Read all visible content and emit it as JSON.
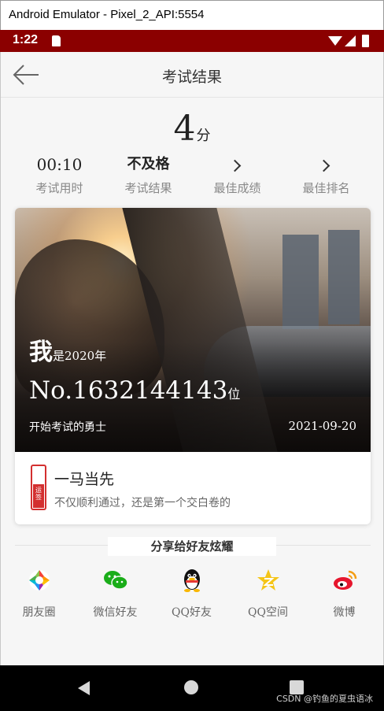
{
  "window": {
    "title": "Android Emulator - Pixel_2_API:5554"
  },
  "status_bar": {
    "time": "1:22"
  },
  "appbar": {
    "title": "考试结果"
  },
  "score": {
    "value": "4",
    "unit": "分"
  },
  "stats": [
    {
      "value": "00:10",
      "label": "考试用时"
    },
    {
      "value": "不及格",
      "label": "考试结果"
    },
    {
      "value": "",
      "label": "最佳成绩"
    },
    {
      "value": "",
      "label": "最佳排名"
    }
  ],
  "rank_card": {
    "me_big": "我",
    "me_small": "是2020年",
    "rank_prefix": "No.1632144143",
    "rank_suffix": "位",
    "caption": "开始考试的勇士",
    "date": "2021-09-20",
    "badge_text": "运签",
    "title": "一马当先",
    "subtitle": "不仅顺利通过，还是第一个交白卷的"
  },
  "share": {
    "title": "分享给好友炫耀",
    "targets": [
      {
        "label": "朋友圈",
        "icon": "moments-icon"
      },
      {
        "label": "微信好友",
        "icon": "wechat-icon"
      },
      {
        "label": "QQ好友",
        "icon": "qq-icon"
      },
      {
        "label": "QQ空间",
        "icon": "qzone-icon"
      },
      {
        "label": "微博",
        "icon": "weibo-icon"
      }
    ]
  },
  "watermark": "CSDN @钓鱼的夏虫语冰",
  "colors": {
    "status_bar": "#8b0000",
    "badge_red": "#d32f2f",
    "wechat_green": "#1aad19",
    "qzone_yellow": "#f5c518",
    "weibo_red": "#e6162d"
  }
}
